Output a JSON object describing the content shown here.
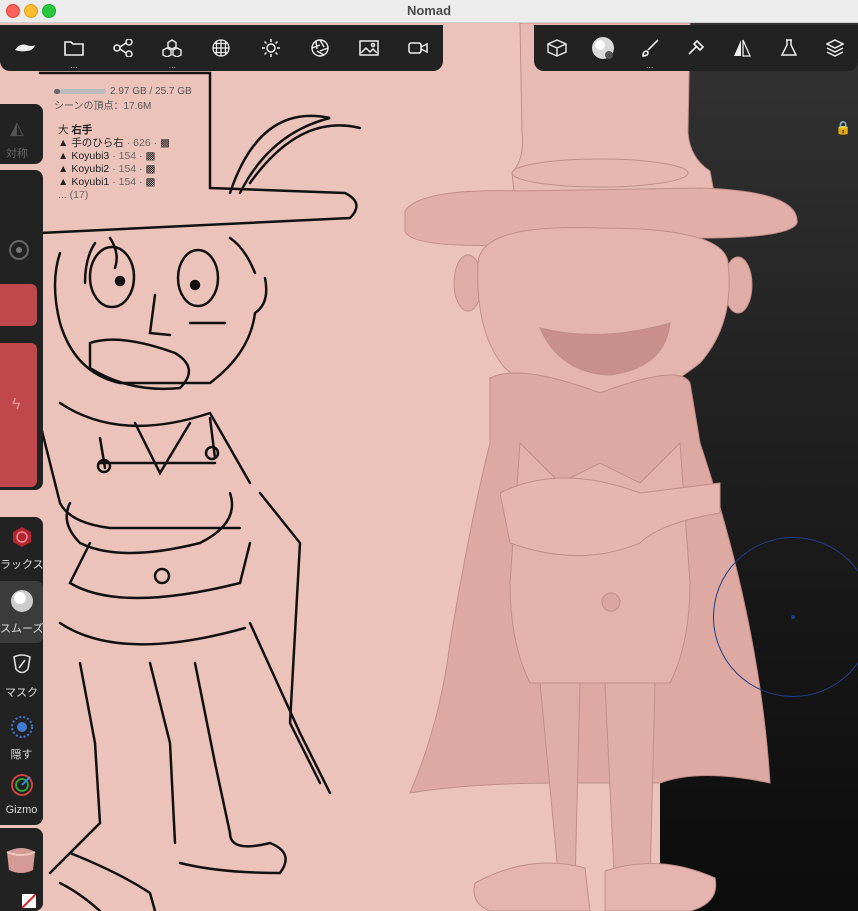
{
  "window": {
    "title": "Nomad"
  },
  "stats": {
    "memory": "2.97 GB / 25.7 GB",
    "memory_fraction": 0.12,
    "scene_vertices": "シーンの頂点：17.6M"
  },
  "scene_tree": {
    "root": "右手",
    "items": [
      {
        "name": "手のひら右",
        "meta": "· 626 ·"
      },
      {
        "name": "Koyubi3",
        "meta": "· 154 ·"
      },
      {
        "name": "Koyubi2",
        "meta": "· 154 ·"
      },
      {
        "name": "Koyubi1",
        "meta": "· 154 ·"
      }
    ],
    "more": "... (17)"
  },
  "top_toolbar_left": [
    "nomad-logo-icon",
    "folder-icon",
    "scene-graph-icon",
    "mesh-icon",
    "sphere-grid-icon",
    "light-icon",
    "aperture-icon",
    "image-icon",
    "video-icon"
  ],
  "top_toolbar_right": [
    "cube-icon",
    "smooth-brush-icon",
    "brush-icon",
    "hammer-icon",
    "symmetry-icon",
    "flask-icon",
    "layers-icon"
  ],
  "left_panel": {
    "symmetry_label": "対称",
    "tools": [
      {
        "label": "ラックス",
        "icon": "relax-icon"
      },
      {
        "label": "スムーズ",
        "icon": "smooth-icon"
      },
      {
        "label": "マスク",
        "icon": "mask-icon"
      },
      {
        "label": "隠す",
        "icon": "hide-icon"
      },
      {
        "label": "Gizmo",
        "icon": "gizmo-icon"
      }
    ]
  },
  "colors": {
    "background": "#ecc3bb",
    "accent_red": "#c0474c",
    "panel": "#222222",
    "brush_ring": "#203f88"
  }
}
